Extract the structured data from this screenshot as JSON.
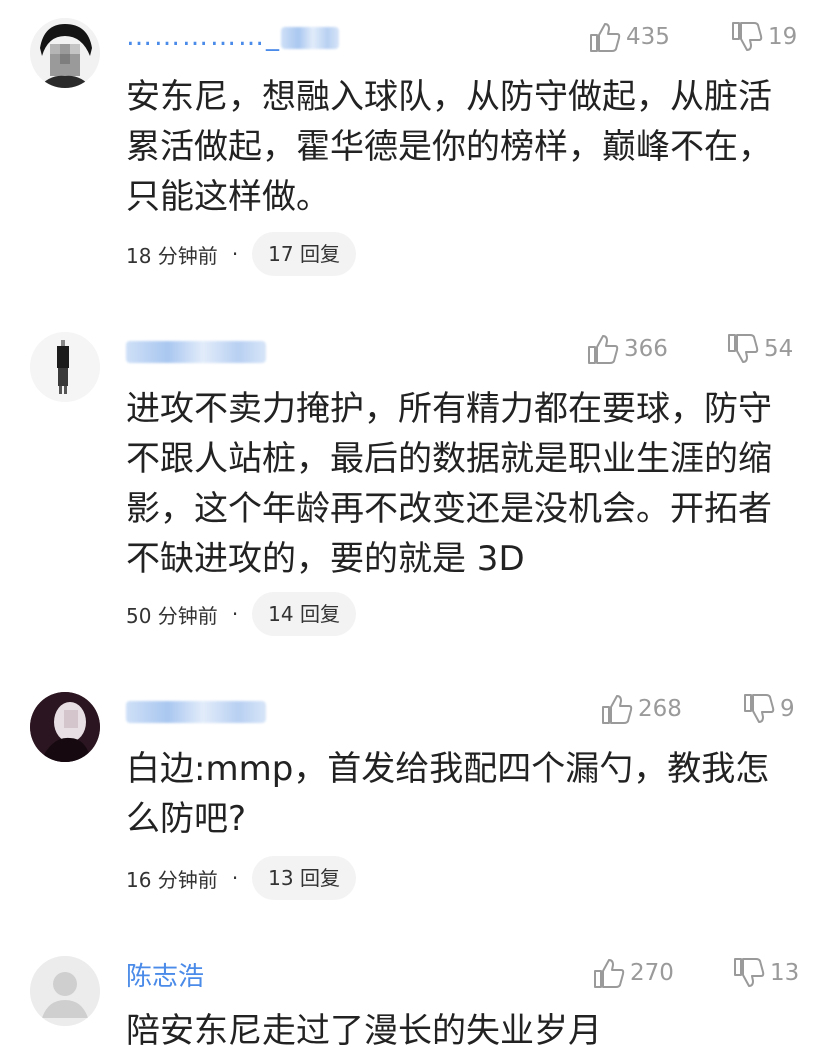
{
  "comments": [
    {
      "username": "……………_",
      "text": "安东尼，想融入球队，从防守做起，从脏活累活做起，霍华德是你的榜样，巅峰不在，只能这样做。",
      "likes": "435",
      "dislikes": "19",
      "time": "18 分钟前",
      "replies": "17 回复"
    },
    {
      "username": "",
      "text": "进攻不卖力掩护，所有精力都在要球，防守不跟人站桩，最后的数据就是职业生涯的缩影，这个年龄再不改变还是没机会。开拓者不缺进攻的，要的就是 3D",
      "likes": "366",
      "dislikes": "54",
      "time": "50 分钟前",
      "replies": "14 回复"
    },
    {
      "username": "",
      "text": "白边:mmp，首发给我配四个漏勺，教我怎么防吧?",
      "likes": "268",
      "dislikes": "9",
      "time": "16 分钟前",
      "replies": "13 回复"
    },
    {
      "username": "陈志浩",
      "text": "陪安东尼走过了漫长的失业岁月",
      "likes": "270",
      "dislikes": "13",
      "time": "",
      "replies": ""
    }
  ],
  "separator": "·",
  "icons": {
    "like": "thumbs-up-icon",
    "dislike": "thumbs-down-icon"
  },
  "colors": {
    "username": "#4a8ae8",
    "text": "#222222",
    "muted": "#9a9a9a",
    "reply_bg": "#f3f3f3"
  }
}
